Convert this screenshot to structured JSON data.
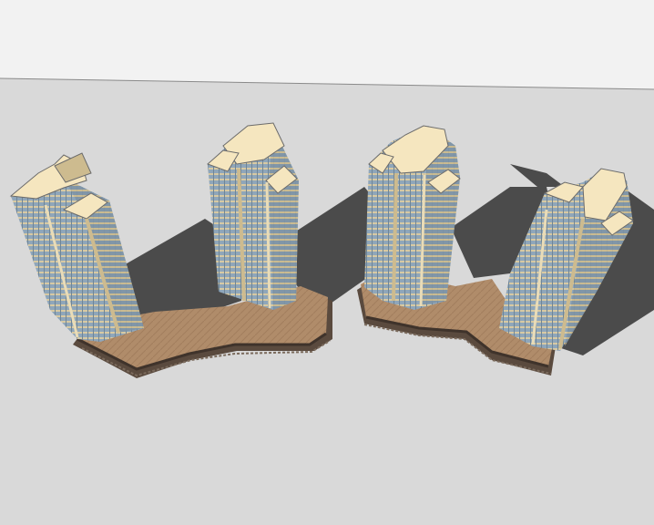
{
  "scene": {
    "sky_color": "#f2f2f2",
    "ground_color": "#d9d9d9",
    "shadow_color": "#4a4a4a",
    "facade_color": "#9bb0c2",
    "cap_color": "#f5e6bf",
    "side_color": "#cdbb8f",
    "podium_top_color": "#b08c6a",
    "podium_side_color": "#5a4a3e",
    "towers": 4,
    "podiums": 2
  }
}
